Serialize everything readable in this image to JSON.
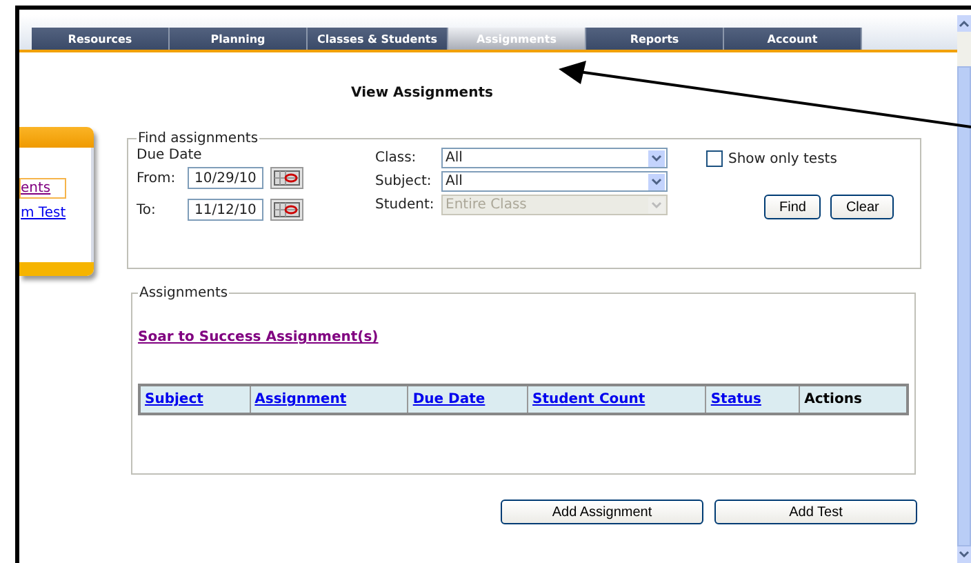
{
  "tabs": [
    {
      "label": "Resources",
      "selected": false
    },
    {
      "label": "Planning",
      "selected": false
    },
    {
      "label": "Classes & Students",
      "selected": false
    },
    {
      "label": "Assignments",
      "selected": true
    },
    {
      "label": "Reports",
      "selected": false
    },
    {
      "label": "Account",
      "selected": false
    }
  ],
  "sidebar": {
    "links": [
      {
        "label": "ents",
        "selected": true
      },
      {
        "label": "m Test",
        "selected": false
      }
    ]
  },
  "title": "View Assignments",
  "find": {
    "legend": "Find assignments",
    "due_date_label": "Due Date",
    "dates": [
      {
        "label": "From:",
        "value": "10/29/10"
      },
      {
        "label": "To:",
        "value": "11/12/10"
      }
    ],
    "filters": [
      {
        "label": "Class:",
        "value": "All",
        "disabled": false
      },
      {
        "label": "Subject:",
        "value": "All",
        "disabled": false
      },
      {
        "label": "Student:",
        "value": "Entire Class",
        "disabled": true
      }
    ],
    "show_only_tests": {
      "label": "Show only tests",
      "checked": false
    },
    "buttons": [
      "Find",
      "Clear"
    ]
  },
  "assignments": {
    "legend": "Assignments",
    "link": "Soar to Success Assignment(s)",
    "table": {
      "columns": [
        {
          "label": "Subject",
          "sortable": true
        },
        {
          "label": "Assignment",
          "sortable": true
        },
        {
          "label": "Due Date",
          "sortable": true
        },
        {
          "label": "Student Count",
          "sortable": true
        },
        {
          "label": "Status",
          "sortable": true
        },
        {
          "label": "Actions",
          "sortable": false
        }
      ]
    }
  },
  "buttons": [
    "Add Assignment",
    "Add Test"
  ]
}
